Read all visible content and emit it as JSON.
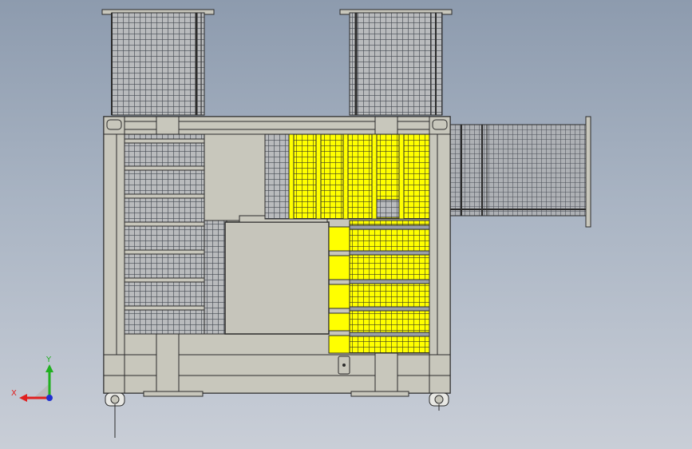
{
  "viewport": {
    "background_top": "#8d9bae",
    "background_bottom": "#c9ced7"
  },
  "model": {
    "frame_color": "#c8c7bc",
    "line_color": "#2b2b2b",
    "mesh_color": "#5a5e66",
    "highlight_color": "#ffff00",
    "panel_color": "#c6c5bb"
  },
  "triad": {
    "x_label": "X",
    "y_label": "Y",
    "x_color": "#e02020",
    "y_color": "#20b020",
    "z_color": "#2030d0"
  }
}
